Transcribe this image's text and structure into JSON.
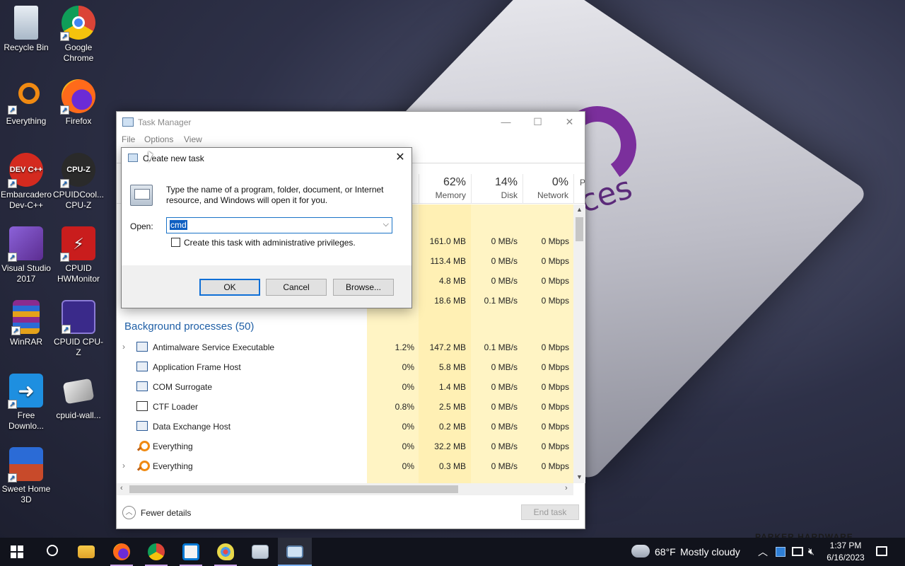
{
  "desktop": {
    "icons": [
      {
        "label": "Recycle Bin",
        "name": "recycle-bin-icon"
      },
      {
        "label": "Google Chrome",
        "name": "chrome-icon"
      },
      {
        "label": "Everything",
        "name": "everything-icon"
      },
      {
        "label": "Firefox",
        "name": "firefox-icon"
      },
      {
        "label": "Embarcadero Dev-C++",
        "name": "devcpp-icon",
        "glyph": "DEV C++"
      },
      {
        "label": "CPUIDCool... CPU-Z",
        "name": "cpuz-cool-icon",
        "glyph": "CPU-Z"
      },
      {
        "label": "Visual Studio 2017",
        "name": "visual-studio-icon"
      },
      {
        "label": "CPUID HWMonitor",
        "name": "hwmonitor-icon"
      },
      {
        "label": "WinRAR",
        "name": "winrar-icon"
      },
      {
        "label": "CPUID CPU-Z",
        "name": "cpuz-icon"
      },
      {
        "label": "Free Downlo...",
        "name": "free-download-icon"
      },
      {
        "label": "cpuid-wall...",
        "name": "cpuid-wallpaper-icon"
      },
      {
        "label": "Sweet Home 3D",
        "name": "sweet-home-icon"
      }
    ],
    "wallpaper_text": "ces",
    "wallpaper_brand": "PARKER HARDWARE"
  },
  "task_manager": {
    "title": "Task Manager",
    "menu": [
      "File",
      "Options",
      "View"
    ],
    "columns": [
      {
        "pct": "62%",
        "label": "Memory"
      },
      {
        "pct": "14%",
        "label": "Disk"
      },
      {
        "pct": "0%",
        "label": "Network"
      },
      {
        "pct": "",
        "label": "P"
      }
    ],
    "app_rows": [
      {
        "mem": "161.0 MB",
        "disk": "0 MB/s",
        "net": "0 Mbps"
      },
      {
        "mem": "113.4 MB",
        "disk": "0 MB/s",
        "net": "0 Mbps"
      },
      {
        "mem": "4.8 MB",
        "disk": "0 MB/s",
        "net": "0 Mbps"
      },
      {
        "mem": "18.6 MB",
        "disk": "0.1 MB/s",
        "net": "0 Mbps"
      }
    ],
    "group_title": "Background processes (50)",
    "bg_rows": [
      {
        "name": "Antimalware Service Executable",
        "cpu": "1.2%",
        "mem": "147.2 MB",
        "disk": "0.1 MB/s",
        "net": "0 Mbps",
        "expand": "›"
      },
      {
        "name": "Application Frame Host",
        "cpu": "0%",
        "mem": "5.8 MB",
        "disk": "0 MB/s",
        "net": "0 Mbps",
        "expand": ""
      },
      {
        "name": "COM Surrogate",
        "cpu": "0%",
        "mem": "1.4 MB",
        "disk": "0 MB/s",
        "net": "0 Mbps",
        "expand": ""
      },
      {
        "name": "CTF Loader",
        "cpu": "0.8%",
        "mem": "2.5 MB",
        "disk": "0 MB/s",
        "net": "0 Mbps",
        "expand": ""
      },
      {
        "name": "Data Exchange Host",
        "cpu": "0%",
        "mem": "0.2 MB",
        "disk": "0 MB/s",
        "net": "0 Mbps",
        "expand": ""
      },
      {
        "name": "Everything",
        "cpu": "0%",
        "mem": "32.2 MB",
        "disk": "0 MB/s",
        "net": "0 Mbps",
        "expand": ""
      },
      {
        "name": "Everything",
        "cpu": "0%",
        "mem": "0.3 MB",
        "disk": "0 MB/s",
        "net": "0 Mbps",
        "expand": "›"
      }
    ],
    "fewer_details": "Fewer details",
    "end_task": "End task"
  },
  "run_dialog": {
    "title": "Create new task",
    "description": "Type the name of a program, folder, document, or Internet resource, and Windows will open it for you.",
    "open_label": "Open:",
    "open_value": "cmd",
    "admin_label": "Create this task with administrative privileges.",
    "ok": "OK",
    "cancel": "Cancel",
    "browse": "Browse..."
  },
  "taskbar": {
    "weather": "68°F",
    "weather_desc": "Mostly cloudy",
    "time": "1:37 PM",
    "date": "6/16/2023"
  }
}
